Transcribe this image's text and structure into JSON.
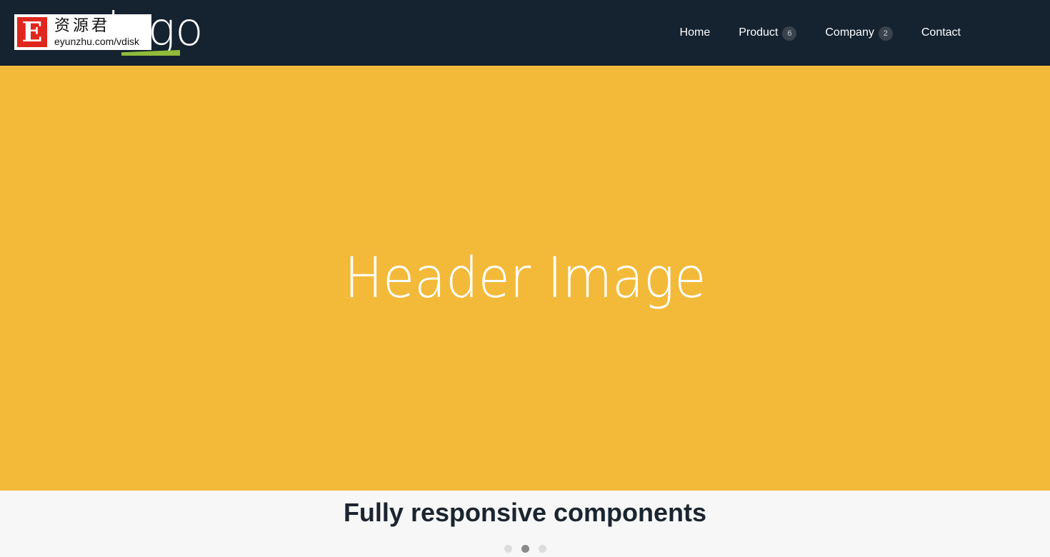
{
  "navbar": {
    "logo_text": "logo",
    "watermark": {
      "letter": "E",
      "chinese": "资源君",
      "url": "eyunzhu.com/vdisk"
    },
    "links": [
      {
        "label": "Home",
        "badge": null
      },
      {
        "label": "Product",
        "badge": "6"
      },
      {
        "label": "Company",
        "badge": "2"
      },
      {
        "label": "Contact",
        "badge": null
      }
    ]
  },
  "hero": {
    "title": "Header Image",
    "background_color": "#f3ba3a"
  },
  "caption": {
    "title": "Fully responsive components"
  },
  "carousel": {
    "slide_count": 3,
    "active_index": 1
  },
  "colors": {
    "navbar_bg": "#152230",
    "accent_green": "#8fba3a",
    "badge_bg": "#3a434c"
  }
}
